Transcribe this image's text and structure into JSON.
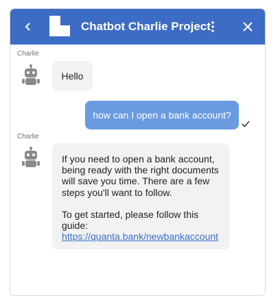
{
  "header": {
    "title": "Chatbot Charlie Project",
    "background_color": "#3c6cc4",
    "icons": {
      "back": "chevron-left-icon",
      "logo": "app-logo-icon",
      "more": "more-vertical-icon",
      "close": "close-icon"
    }
  },
  "messages": [
    {
      "sender": "Charlie",
      "direction": "incoming",
      "avatar_icon": "robot-icon",
      "text": "Hello"
    },
    {
      "direction": "outgoing",
      "text": "how can I open a bank account?",
      "status_icon": "check-icon"
    },
    {
      "sender": "Charlie",
      "direction": "incoming",
      "avatar_icon": "robot-icon",
      "paragraph_1": "If you need to open a bank account, being ready with the right documents will save you time. There are a few steps you'll want to follow.",
      "paragraph_2": "To get started, please follow this guide:",
      "link_text": "https://quanta.bank/newbankaccount"
    }
  ],
  "colors": {
    "outgoing_bubble": "#6a9be0",
    "incoming_bubble": "#f2f2f2",
    "link": "#3a6fc9"
  }
}
